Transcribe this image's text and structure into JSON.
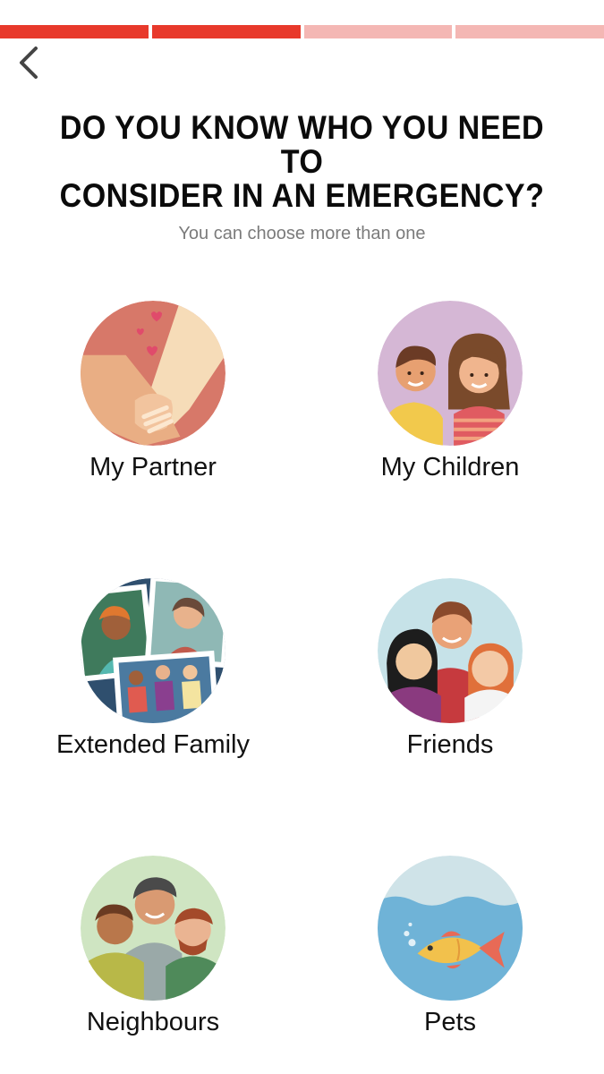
{
  "progress": {
    "total_steps": 4,
    "completed_steps": 2,
    "active_color": "#e8392b",
    "inactive_color": "#f4b7b4"
  },
  "nav": {
    "back_icon": "chevron-left-icon"
  },
  "header": {
    "title_line1": "DO YOU KNOW WHO YOU NEED TO",
    "title_line2": "CONSIDER IN AN EMERGENCY?",
    "subtitle": "You can choose more than one"
  },
  "options": [
    {
      "label": "My Partner",
      "icon": "holding-hands-icon"
    },
    {
      "label": "My Children",
      "icon": "children-icon"
    },
    {
      "label": "Extended Family",
      "icon": "family-photos-icon"
    },
    {
      "label": "Friends",
      "icon": "friends-icon"
    },
    {
      "label": "Neighbours",
      "icon": "neighbours-icon"
    },
    {
      "label": "Pets",
      "icon": "fish-icon"
    }
  ]
}
